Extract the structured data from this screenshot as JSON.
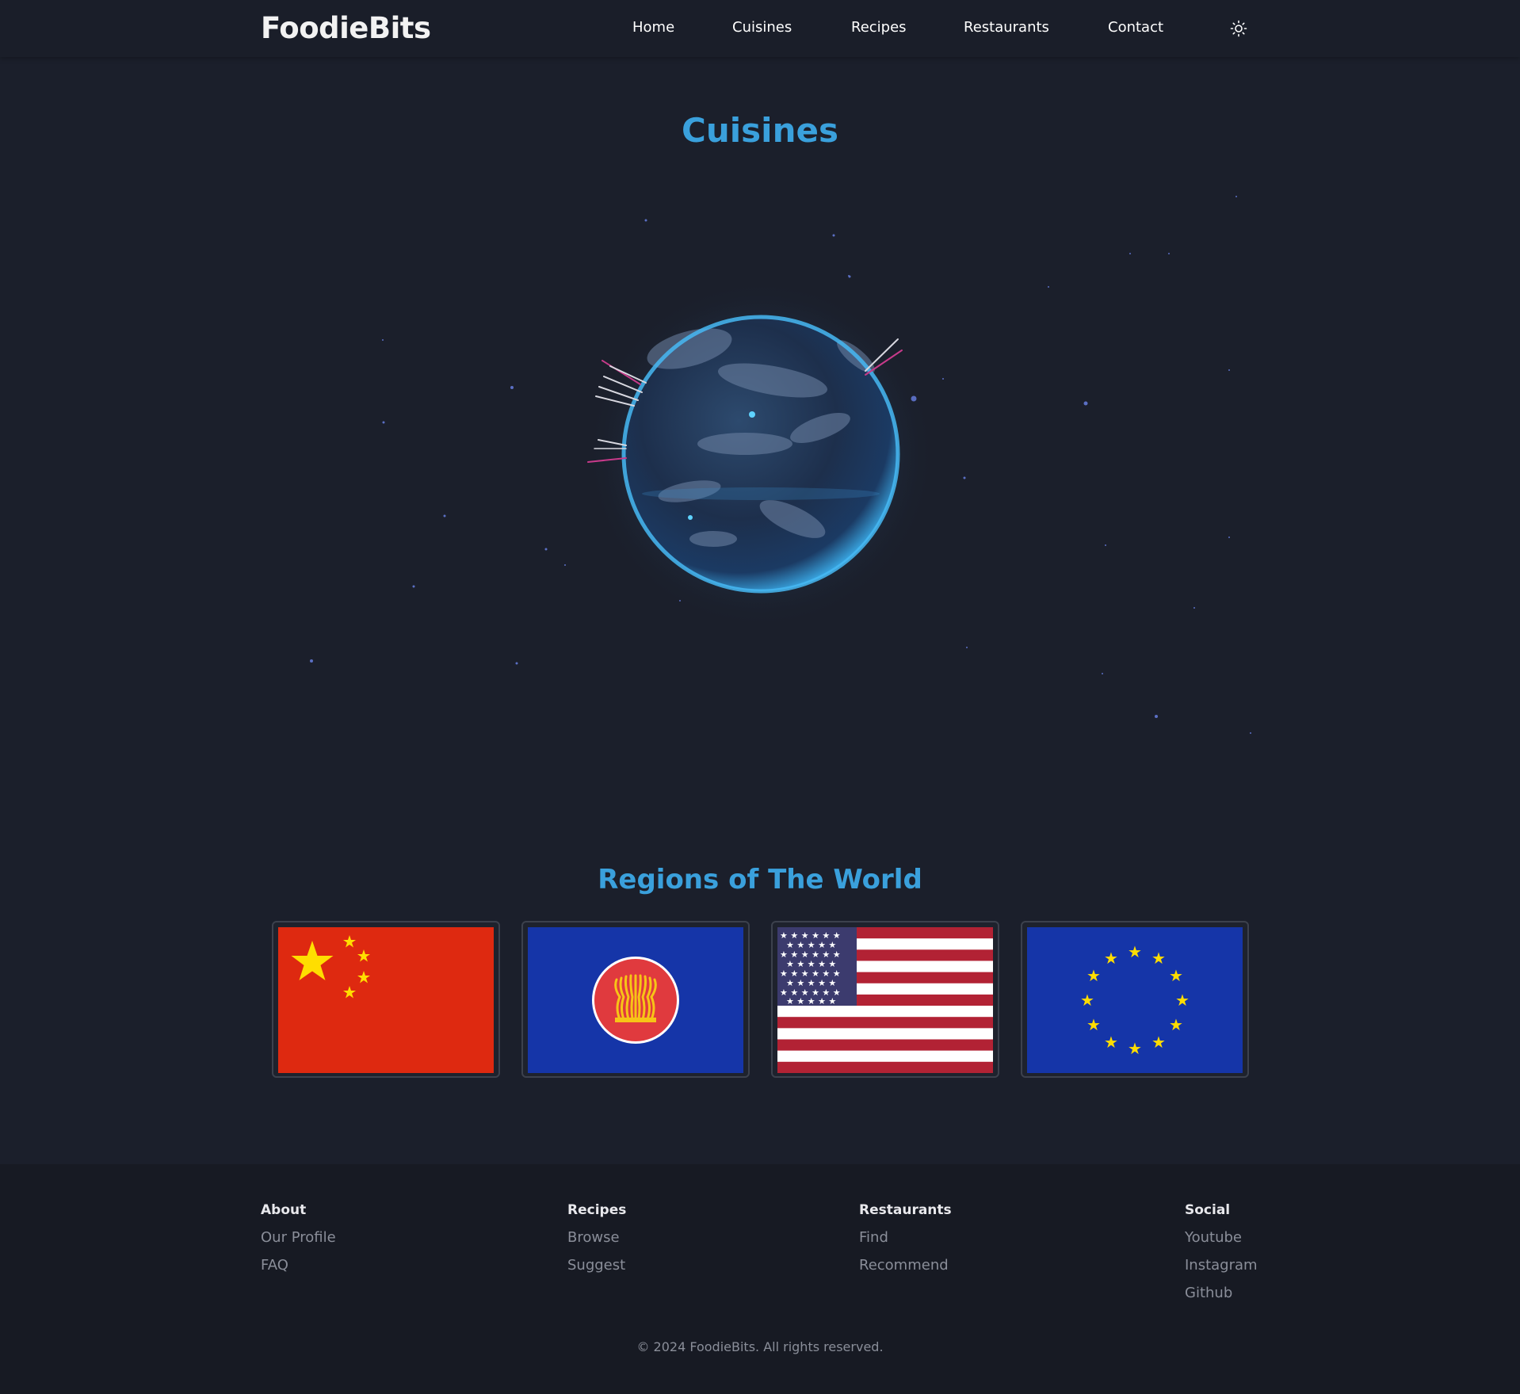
{
  "header": {
    "logo": "FoodieBits",
    "nav": [
      "Home",
      "Cuisines",
      "Recipes",
      "Restaurants",
      "Contact"
    ],
    "theme_toggle_icon": "sun-icon"
  },
  "hero": {
    "title": "Cuisines",
    "globe_icon": "globe-icon"
  },
  "regions": {
    "title": "Regions of The World",
    "flags": [
      "china-flag-icon",
      "asean-flag-icon",
      "usa-flag-icon",
      "eu-flag-icon"
    ]
  },
  "footer": {
    "columns": [
      {
        "heading": "About",
        "links": [
          "Our Profile",
          "FAQ"
        ]
      },
      {
        "heading": "Recipes",
        "links": [
          "Browse",
          "Suggest"
        ]
      },
      {
        "heading": "Restaurants",
        "links": [
          "Find",
          "Recommend"
        ]
      },
      {
        "heading": "Social",
        "links": [
          "Youtube",
          "Instagram",
          "Github"
        ]
      }
    ],
    "copyright": "© 2024 FoodieBits. All rights reserved."
  },
  "colors": {
    "background": "#1b1f2b",
    "accent": "#3aa0dc",
    "footer_bg": "#171a23"
  }
}
